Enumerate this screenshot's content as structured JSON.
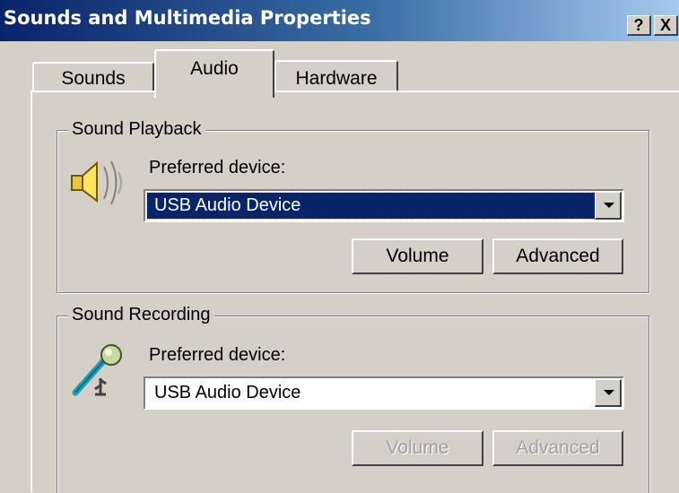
{
  "window": {
    "title": "Sounds and Multimedia Properties",
    "help_button": "?",
    "close_button": "X"
  },
  "tabs": [
    {
      "label": "Sounds",
      "active": false
    },
    {
      "label": "Audio",
      "active": true
    },
    {
      "label": "Hardware",
      "active": false
    }
  ],
  "playback": {
    "group_label": "Sound Playback",
    "icon": "speaker-icon",
    "preferred_label": "Preferred device:",
    "device": "USB Audio Device",
    "volume_button": "Volume",
    "advanced_button": "Advanced"
  },
  "recording": {
    "group_label": "Sound Recording",
    "icon": "microphone-icon",
    "preferred_label": "Preferred device:",
    "device": "USB Audio Device",
    "volume_button": "Volume",
    "advanced_button": "Advanced",
    "buttons_disabled": true
  },
  "colors": {
    "titlebar_start": "#0a246a",
    "titlebar_end": "#a6caf0",
    "face": "#d4d0c8",
    "selection": "#0a246a"
  }
}
